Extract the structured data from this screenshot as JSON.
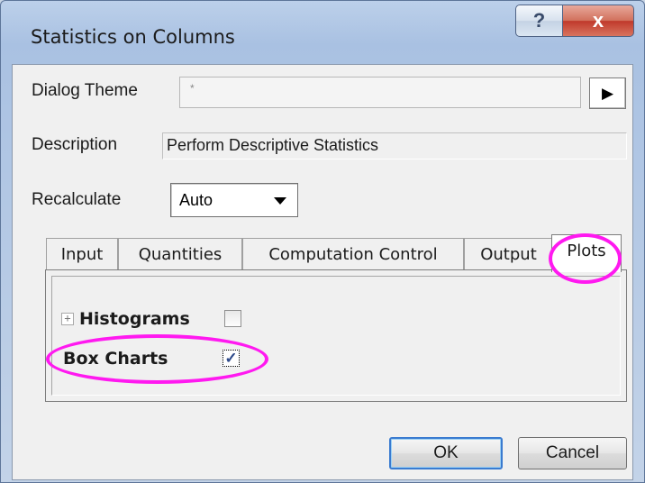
{
  "window": {
    "title": "Statistics on Columns",
    "help_glyph": "?",
    "close_glyph": "x"
  },
  "dialog_theme": {
    "label": "Dialog Theme",
    "value": "*",
    "menu_glyph": "▶"
  },
  "description": {
    "label": "Description",
    "value": "Perform Descriptive Statistics"
  },
  "recalculate": {
    "label": "Recalculate",
    "selected": "Auto"
  },
  "tabs": [
    {
      "label": "Input"
    },
    {
      "label": "Quantities"
    },
    {
      "label": "Computation Control"
    },
    {
      "label": "Output"
    },
    {
      "label": "Plots",
      "active": true
    }
  ],
  "plots": {
    "histograms_label": "Histograms",
    "histograms_checked": false,
    "expand_glyph": "+",
    "box_charts_label": "Box Charts",
    "box_charts_checked": true,
    "check_glyph": "✓"
  },
  "buttons": {
    "ok": "OK",
    "cancel": "Cancel"
  },
  "colors": {
    "highlight": "#ff19f0",
    "close_button": "#c0392b",
    "default_button_border": "#3a7bd0"
  }
}
